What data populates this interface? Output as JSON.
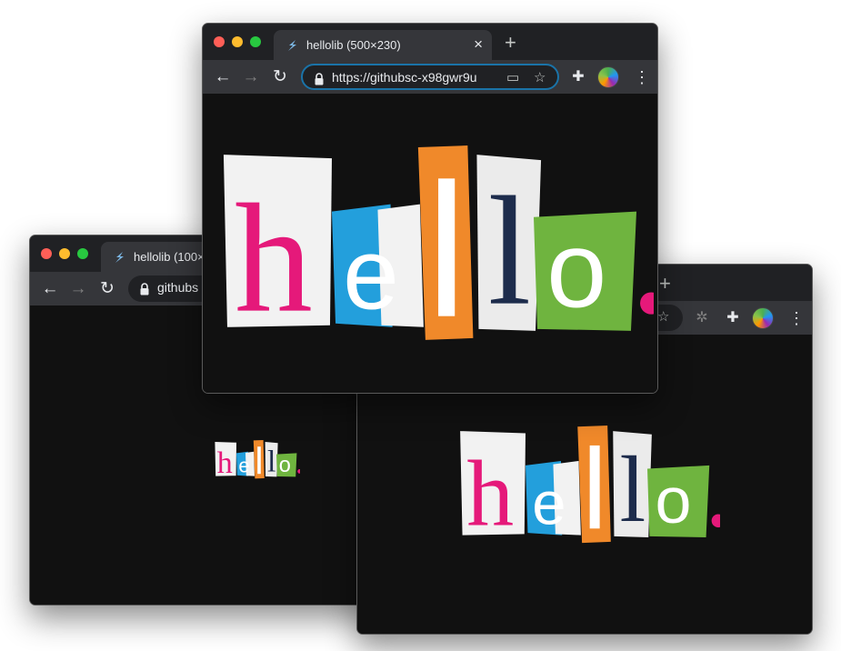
{
  "windows": [
    {
      "tab_title": "hellolib (100×",
      "url_text": "githubs",
      "logo_text": "hello"
    },
    {
      "logo_text": "hello"
    },
    {
      "tab_title": "hellolib (500×230)",
      "url_text": "https://githubsc-x98gwr9u",
      "tab_close": "×",
      "new_tab": "+",
      "logo_text": "hello"
    }
  ],
  "second_window_new_tab": "+",
  "icons": [
    "close-red-icon",
    "minimize-yellow-icon",
    "zoom-green-icon",
    "favicon-icon",
    "back-arrow-icon",
    "forward-arrow-icon",
    "reload-icon",
    "lock-icon",
    "cast-icon",
    "star-icon",
    "extension-puzzle-icon",
    "bug-icon",
    "avatar-icon",
    "more-menu-icon"
  ],
  "colors": {
    "pink": "#e5197a",
    "blue": "#239fdc",
    "orange": "#f0892a",
    "white_card": "#f2f2f2",
    "navy": "#1d2c4c",
    "green": "#6fb43f",
    "focus_ring": "#1a73a8"
  }
}
